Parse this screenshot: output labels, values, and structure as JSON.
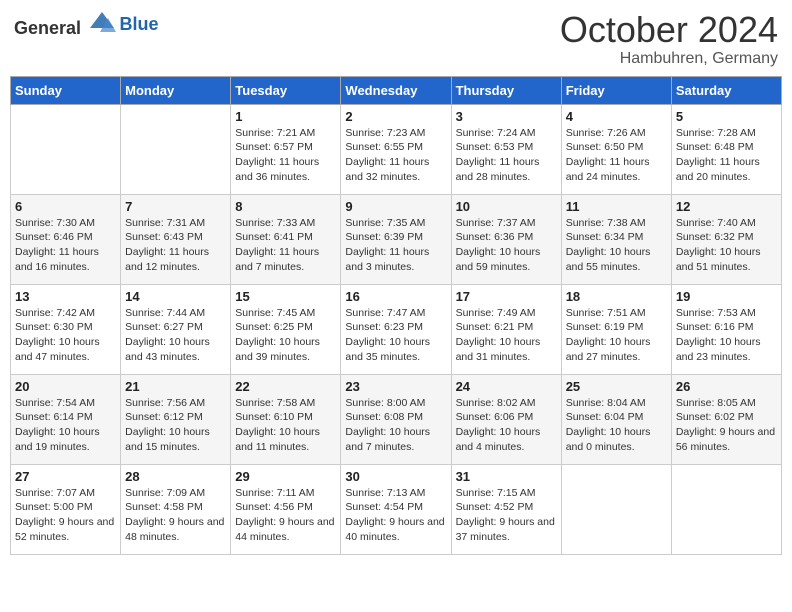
{
  "header": {
    "logo_general": "General",
    "logo_blue": "Blue",
    "month": "October 2024",
    "location": "Hambuhren, Germany"
  },
  "days_of_week": [
    "Sunday",
    "Monday",
    "Tuesday",
    "Wednesday",
    "Thursday",
    "Friday",
    "Saturday"
  ],
  "weeks": [
    [
      {
        "day": "",
        "content": ""
      },
      {
        "day": "",
        "content": ""
      },
      {
        "day": "1",
        "content": "Sunrise: 7:21 AM\nSunset: 6:57 PM\nDaylight: 11 hours and 36 minutes."
      },
      {
        "day": "2",
        "content": "Sunrise: 7:23 AM\nSunset: 6:55 PM\nDaylight: 11 hours and 32 minutes."
      },
      {
        "day": "3",
        "content": "Sunrise: 7:24 AM\nSunset: 6:53 PM\nDaylight: 11 hours and 28 minutes."
      },
      {
        "day": "4",
        "content": "Sunrise: 7:26 AM\nSunset: 6:50 PM\nDaylight: 11 hours and 24 minutes."
      },
      {
        "day": "5",
        "content": "Sunrise: 7:28 AM\nSunset: 6:48 PM\nDaylight: 11 hours and 20 minutes."
      }
    ],
    [
      {
        "day": "6",
        "content": "Sunrise: 7:30 AM\nSunset: 6:46 PM\nDaylight: 11 hours and 16 minutes."
      },
      {
        "day": "7",
        "content": "Sunrise: 7:31 AM\nSunset: 6:43 PM\nDaylight: 11 hours and 12 minutes."
      },
      {
        "day": "8",
        "content": "Sunrise: 7:33 AM\nSunset: 6:41 PM\nDaylight: 11 hours and 7 minutes."
      },
      {
        "day": "9",
        "content": "Sunrise: 7:35 AM\nSunset: 6:39 PM\nDaylight: 11 hours and 3 minutes."
      },
      {
        "day": "10",
        "content": "Sunrise: 7:37 AM\nSunset: 6:36 PM\nDaylight: 10 hours and 59 minutes."
      },
      {
        "day": "11",
        "content": "Sunrise: 7:38 AM\nSunset: 6:34 PM\nDaylight: 10 hours and 55 minutes."
      },
      {
        "day": "12",
        "content": "Sunrise: 7:40 AM\nSunset: 6:32 PM\nDaylight: 10 hours and 51 minutes."
      }
    ],
    [
      {
        "day": "13",
        "content": "Sunrise: 7:42 AM\nSunset: 6:30 PM\nDaylight: 10 hours and 47 minutes."
      },
      {
        "day": "14",
        "content": "Sunrise: 7:44 AM\nSunset: 6:27 PM\nDaylight: 10 hours and 43 minutes."
      },
      {
        "day": "15",
        "content": "Sunrise: 7:45 AM\nSunset: 6:25 PM\nDaylight: 10 hours and 39 minutes."
      },
      {
        "day": "16",
        "content": "Sunrise: 7:47 AM\nSunset: 6:23 PM\nDaylight: 10 hours and 35 minutes."
      },
      {
        "day": "17",
        "content": "Sunrise: 7:49 AM\nSunset: 6:21 PM\nDaylight: 10 hours and 31 minutes."
      },
      {
        "day": "18",
        "content": "Sunrise: 7:51 AM\nSunset: 6:19 PM\nDaylight: 10 hours and 27 minutes."
      },
      {
        "day": "19",
        "content": "Sunrise: 7:53 AM\nSunset: 6:16 PM\nDaylight: 10 hours and 23 minutes."
      }
    ],
    [
      {
        "day": "20",
        "content": "Sunrise: 7:54 AM\nSunset: 6:14 PM\nDaylight: 10 hours and 19 minutes."
      },
      {
        "day": "21",
        "content": "Sunrise: 7:56 AM\nSunset: 6:12 PM\nDaylight: 10 hours and 15 minutes."
      },
      {
        "day": "22",
        "content": "Sunrise: 7:58 AM\nSunset: 6:10 PM\nDaylight: 10 hours and 11 minutes."
      },
      {
        "day": "23",
        "content": "Sunrise: 8:00 AM\nSunset: 6:08 PM\nDaylight: 10 hours and 7 minutes."
      },
      {
        "day": "24",
        "content": "Sunrise: 8:02 AM\nSunset: 6:06 PM\nDaylight: 10 hours and 4 minutes."
      },
      {
        "day": "25",
        "content": "Sunrise: 8:04 AM\nSunset: 6:04 PM\nDaylight: 10 hours and 0 minutes."
      },
      {
        "day": "26",
        "content": "Sunrise: 8:05 AM\nSunset: 6:02 PM\nDaylight: 9 hours and 56 minutes."
      }
    ],
    [
      {
        "day": "27",
        "content": "Sunrise: 7:07 AM\nSunset: 5:00 PM\nDaylight: 9 hours and 52 minutes."
      },
      {
        "day": "28",
        "content": "Sunrise: 7:09 AM\nSunset: 4:58 PM\nDaylight: 9 hours and 48 minutes."
      },
      {
        "day": "29",
        "content": "Sunrise: 7:11 AM\nSunset: 4:56 PM\nDaylight: 9 hours and 44 minutes."
      },
      {
        "day": "30",
        "content": "Sunrise: 7:13 AM\nSunset: 4:54 PM\nDaylight: 9 hours and 40 minutes."
      },
      {
        "day": "31",
        "content": "Sunrise: 7:15 AM\nSunset: 4:52 PM\nDaylight: 9 hours and 37 minutes."
      },
      {
        "day": "",
        "content": ""
      },
      {
        "day": "",
        "content": ""
      }
    ]
  ]
}
